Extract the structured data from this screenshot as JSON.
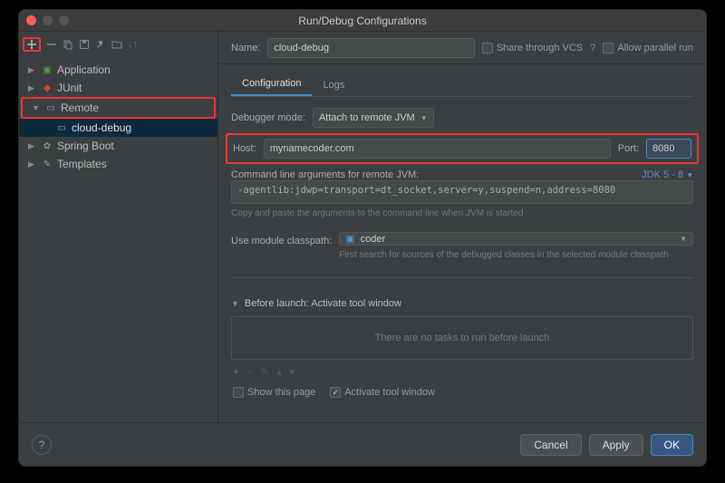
{
  "window": {
    "title": "Run/Debug Configurations"
  },
  "toolbar_icons": {
    "add": "+",
    "remove": "−",
    "copy": "copy-icon",
    "save": "save-icon",
    "wrench": "wrench-icon",
    "folder": "folder-icon",
    "sort": "sort-icon"
  },
  "tree": {
    "items": [
      {
        "label": "Application",
        "icon": "app"
      },
      {
        "label": "JUnit",
        "icon": "junit"
      },
      {
        "label": "Remote",
        "icon": "remote",
        "highlighted": true,
        "children": [
          {
            "label": "cloud-debug",
            "icon": "remote",
            "selected": true
          }
        ]
      },
      {
        "label": "Spring Boot",
        "icon": "spring"
      },
      {
        "label": "Templates",
        "icon": "tmpl"
      }
    ]
  },
  "nameRow": {
    "label": "Name:",
    "value": "cloud-debug",
    "share_label": "Share through VCS",
    "share_help": "?",
    "parallel_label": "Allow parallel run"
  },
  "tabs": [
    {
      "label": "Configuration",
      "active": true
    },
    {
      "label": "Logs"
    }
  ],
  "debugger": {
    "label": "Debugger mode:",
    "value": "Attach to remote JVM"
  },
  "hostport": {
    "host_label": "Host:",
    "host": "mynamecoder.com",
    "port_label": "Port:",
    "port": "8080"
  },
  "cmdline": {
    "label": "Command line arguments for remote JVM:",
    "jdk_link": "JDK 5 - 8",
    "value": "-agentlib:jdwp=transport=dt_socket,server=y,suspend=n,address=8080",
    "hint": "Copy and paste the arguments to the command line when JVM is started"
  },
  "module": {
    "label": "Use module classpath:",
    "value": "coder",
    "hint": "First search for sources of the debugged classes in the selected module classpath"
  },
  "beforeLaunch": {
    "title": "Before launch: Activate tool window",
    "empty": "There are no tasks to run before launch",
    "tools": {
      "add": "+",
      "remove": "−",
      "edit": "edit-icon",
      "up": "up-icon",
      "down": "down-icon"
    },
    "show_page": "Show this page",
    "activate_win": "Activate tool window"
  },
  "footer": {
    "help": "?",
    "cancel": "Cancel",
    "apply": "Apply",
    "ok": "OK"
  }
}
